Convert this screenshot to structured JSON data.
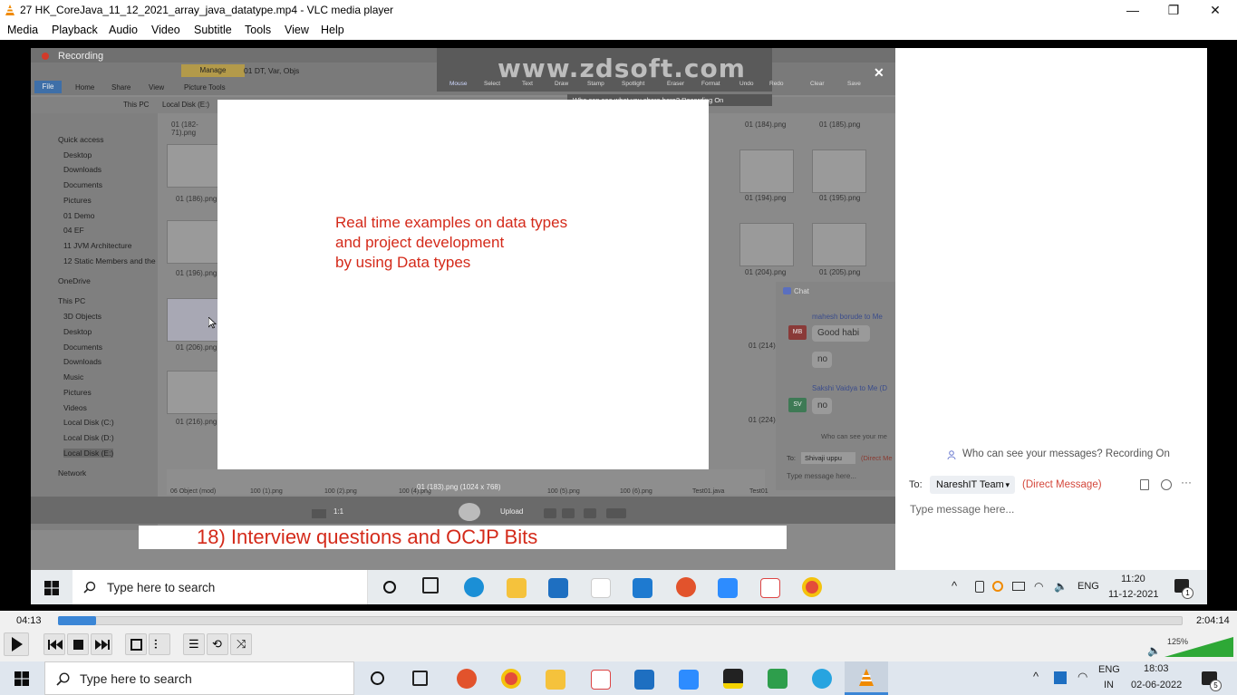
{
  "window": {
    "title": "27 HK_CoreJava_11_12_2021_array_java_datatype.mp4 - VLC media player",
    "minimize": "—",
    "maximize": "❐",
    "close": "✕"
  },
  "menu": {
    "items": [
      {
        "label": "Media"
      },
      {
        "label": "Playback"
      },
      {
        "label": "Audio"
      },
      {
        "label": "Video"
      },
      {
        "label": "Subtitle"
      },
      {
        "label": "Tools"
      },
      {
        "label": "View"
      },
      {
        "label": "Help"
      }
    ]
  },
  "video": {
    "recording_label": "Recording",
    "ribbon": {
      "manage": "Manage",
      "path_title": "01 DT, Var, Objs",
      "tabs": [
        "File",
        "Home",
        "Share",
        "View",
        "Picture Tools"
      ]
    },
    "watermark": "www.zdsoft.com",
    "annot_tools": [
      "Mouse",
      "Select",
      "Text",
      "Draw",
      "Stamp",
      "Spotlight",
      "Eraser",
      "Format",
      "Undo",
      "Redo",
      "Clear",
      "Save"
    ],
    "annot_note": "Who can see what you share here? Recording On",
    "close_x": "✕",
    "breadcrumb": [
      "This PC",
      "Local Disk (E:)"
    ],
    "sidebar": [
      "Quick access",
      "Desktop",
      "Downloads",
      "Documents",
      "Pictures",
      "01 Demo",
      "04 EF",
      "11 JVM Architecture",
      "12 Static Members and the",
      "OneDrive",
      "This PC",
      "3D Objects",
      "Desktop",
      "Documents",
      "Downloads",
      "Music",
      "Pictures",
      "Videos",
      "Local Disk (C:)",
      "Local Disk (D:)",
      "Local Disk (E:)",
      "Network"
    ],
    "thumbs_left": [
      "01 (182-71).png",
      "01 (186).png",
      "01 (196).png",
      "01 (206).png",
      "01 (216).png"
    ],
    "thumbs_right": [
      "01 (184).png",
      "01 (185).png",
      "01 (194).png",
      "01 (195).png",
      "01 (204).png",
      "01 (205).png",
      "01 (214).",
      "01 (224)."
    ],
    "slide": {
      "lines": [
        "Real time examples on data types",
        "and project development",
        "by using Data types"
      ]
    },
    "image_info": "01 (183).png (1024 x 768)",
    "viewer_buttons": [
      "Upload",
      "1:1"
    ],
    "chat": {
      "title": "Chat",
      "messages": [
        {
          "initials": "MB",
          "sender": "mahesh borude to Me",
          "text": "Good habi"
        },
        {
          "initials": "",
          "sender": "",
          "text": "no"
        },
        {
          "initials": "SV",
          "sender": "Sakshi Vaidya to Me (D",
          "text": "no"
        }
      ],
      "who_can_see": "Who can see your me",
      "to_label": "To:",
      "to_value": "Shivaji uppu",
      "direct": "(Direct Me",
      "placeholder": "Type message here..."
    },
    "bottom_thumbs": [
      "06 Object (mod)",
      "100 (1).png",
      "100 (2).png",
      "100 (4).png",
      "100 (5).png",
      "100 (6).png",
      "Test01.java",
      "Test01"
    ],
    "banner": "18) Interview questions and OCJP Bits",
    "zoom_panel": {
      "who_can_see": "Who can see your messages? Recording On",
      "to_label": "To:",
      "to_value": "NareshIT Team",
      "direct_message": "(Direct Message)",
      "placeholder": "Type message here..."
    },
    "inner_taskbar": {
      "search_placeholder": "Type here to search",
      "lang": "ENG",
      "time": "11:20",
      "date": "11-12-2021",
      "notif_count": "1"
    }
  },
  "player": {
    "elapsed": "04:13",
    "total": "2:04:14",
    "progress_fraction": 0.034,
    "volume": "125%"
  },
  "taskbar": {
    "search_placeholder": "Type here to search",
    "lang_line1": "ENG",
    "lang_line2": "IN",
    "time": "18:03",
    "date": "02-06-2022",
    "notif_count": "5"
  },
  "colors": {
    "slide_text": "#d42a1a",
    "progress": "#3b86d6",
    "volume_green": "#2ea836"
  }
}
